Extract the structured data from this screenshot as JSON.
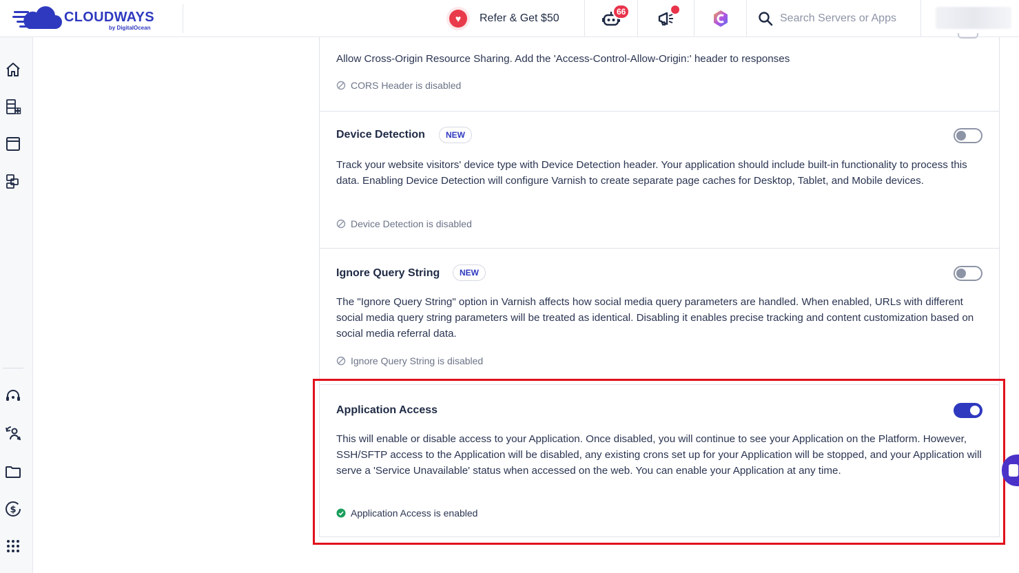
{
  "brand": {
    "name": "CLOUDWAYS",
    "sub": "by DigitalOcean",
    "color": "#2f39bf"
  },
  "topbar": {
    "refer_label": "Refer & Get $50",
    "bot_badge": "66",
    "search_placeholder": "Search Servers or Apps"
  },
  "sidebar": {
    "top_items": [
      "home-icon",
      "servers-icon",
      "applications-icon",
      "projects-icon"
    ],
    "bottom_items": [
      "support-icon",
      "team-icon",
      "files-icon",
      "billing-icon",
      "apps-grid-icon"
    ]
  },
  "sections": [
    {
      "id": "cors",
      "desc": "Allow Cross-Origin Resource Sharing. Add the 'Access-Control-Allow-Origin:' header to responses",
      "status": "CORS Header is disabled"
    },
    {
      "id": "device-detection",
      "title": "Device Detection",
      "badge": "NEW",
      "desc": "Track your website visitors' device type with Device Detection header. Your application should include built-in functionality to process this data. Enabling Device Detection will configure Varnish to create separate page caches for Desktop, Tablet, and Mobile devices.",
      "status": "Device Detection is disabled",
      "enabled": false
    },
    {
      "id": "ignore-query-string",
      "title": "Ignore Query String",
      "badge": "NEW",
      "desc": "The \"Ignore Query String\" option in Varnish affects how social media query parameters are handled. When enabled, URLs with different social media query string parameters will be treated as identical. Disabling it enables precise tracking and content customization based on social media referral data.",
      "status": "Ignore Query String is disabled",
      "enabled": false
    },
    {
      "id": "application-access",
      "title": "Application Access",
      "desc": "This will enable or disable access to your Application. Once disabled, you will continue to see your Application on the Platform. However, SSH/SFTP access to the Application will be disabled, any existing crons set up for your Application will be stopped, and your Application will serve a 'Service Unavailable' status when accessed on the web. You can enable your Application at any time.",
      "status": "Application Access is enabled",
      "enabled": true
    }
  ],
  "colors": {
    "accent": "#2f39bf",
    "highlight": "#e10f1b",
    "success": "#1a9e5c",
    "danger": "#e8334a"
  }
}
